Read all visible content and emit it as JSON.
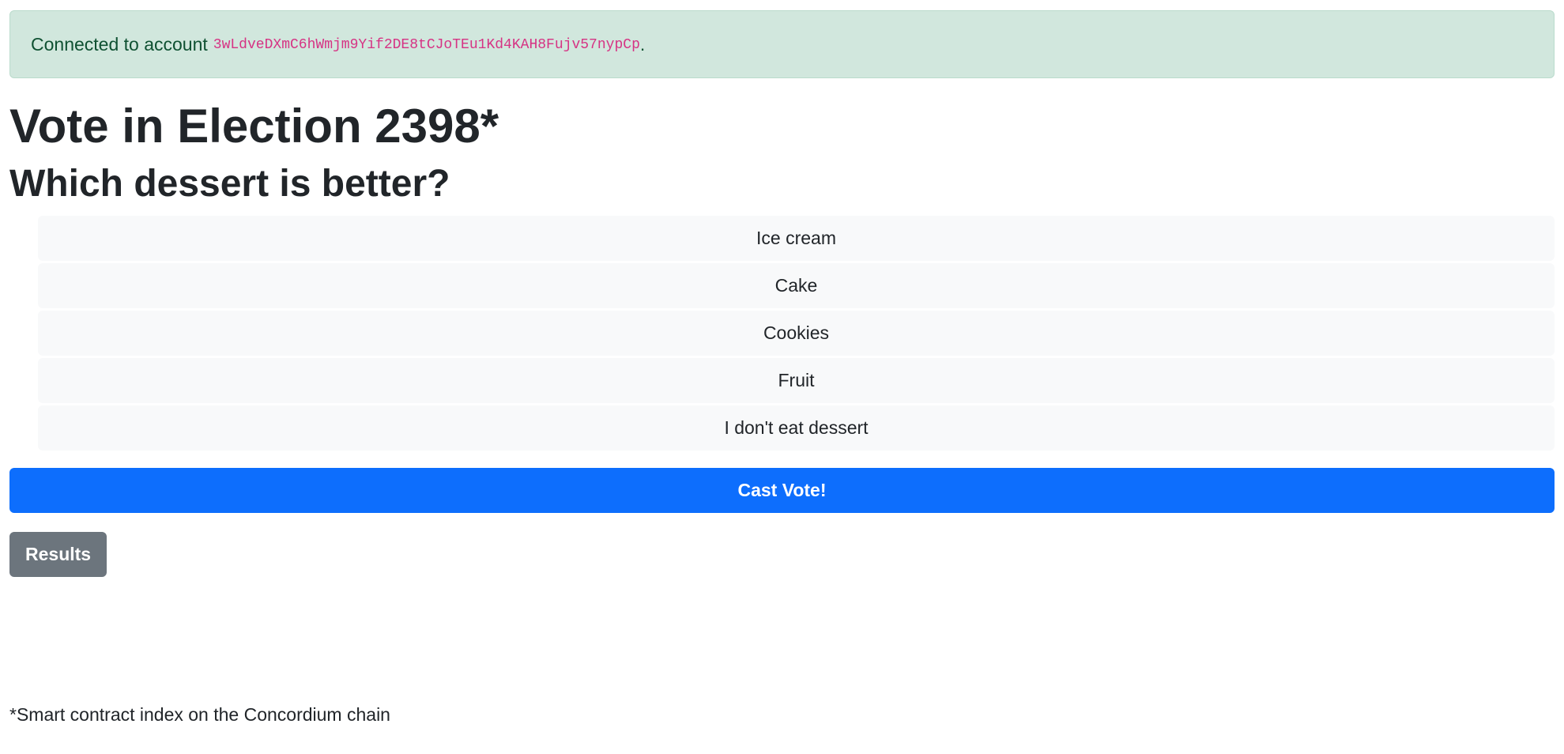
{
  "alert": {
    "prefix": "Connected to account",
    "account": "3wLdveDXmC6hWmjm9Yif2DE8tCJoTEu1Kd4KAH8Fujv57nypCp",
    "suffix": "."
  },
  "page_title": "Vote in Election 2398*",
  "question": "Which dessert is better?",
  "options": [
    {
      "label": "Ice cream"
    },
    {
      "label": "Cake"
    },
    {
      "label": "Cookies"
    },
    {
      "label": "Fruit"
    },
    {
      "label": "I don't eat dessert"
    }
  ],
  "cast_vote_label": "Cast Vote!",
  "results_label": "Results",
  "footnote": "*Smart contract index on the Concordium chain",
  "colors": {
    "primary": "#0d6efd",
    "secondary": "#6c757d",
    "success_bg": "#d1e7dd",
    "success_text": "#0f5132",
    "code": "#d63384",
    "option_bg": "#f8f9fa"
  }
}
